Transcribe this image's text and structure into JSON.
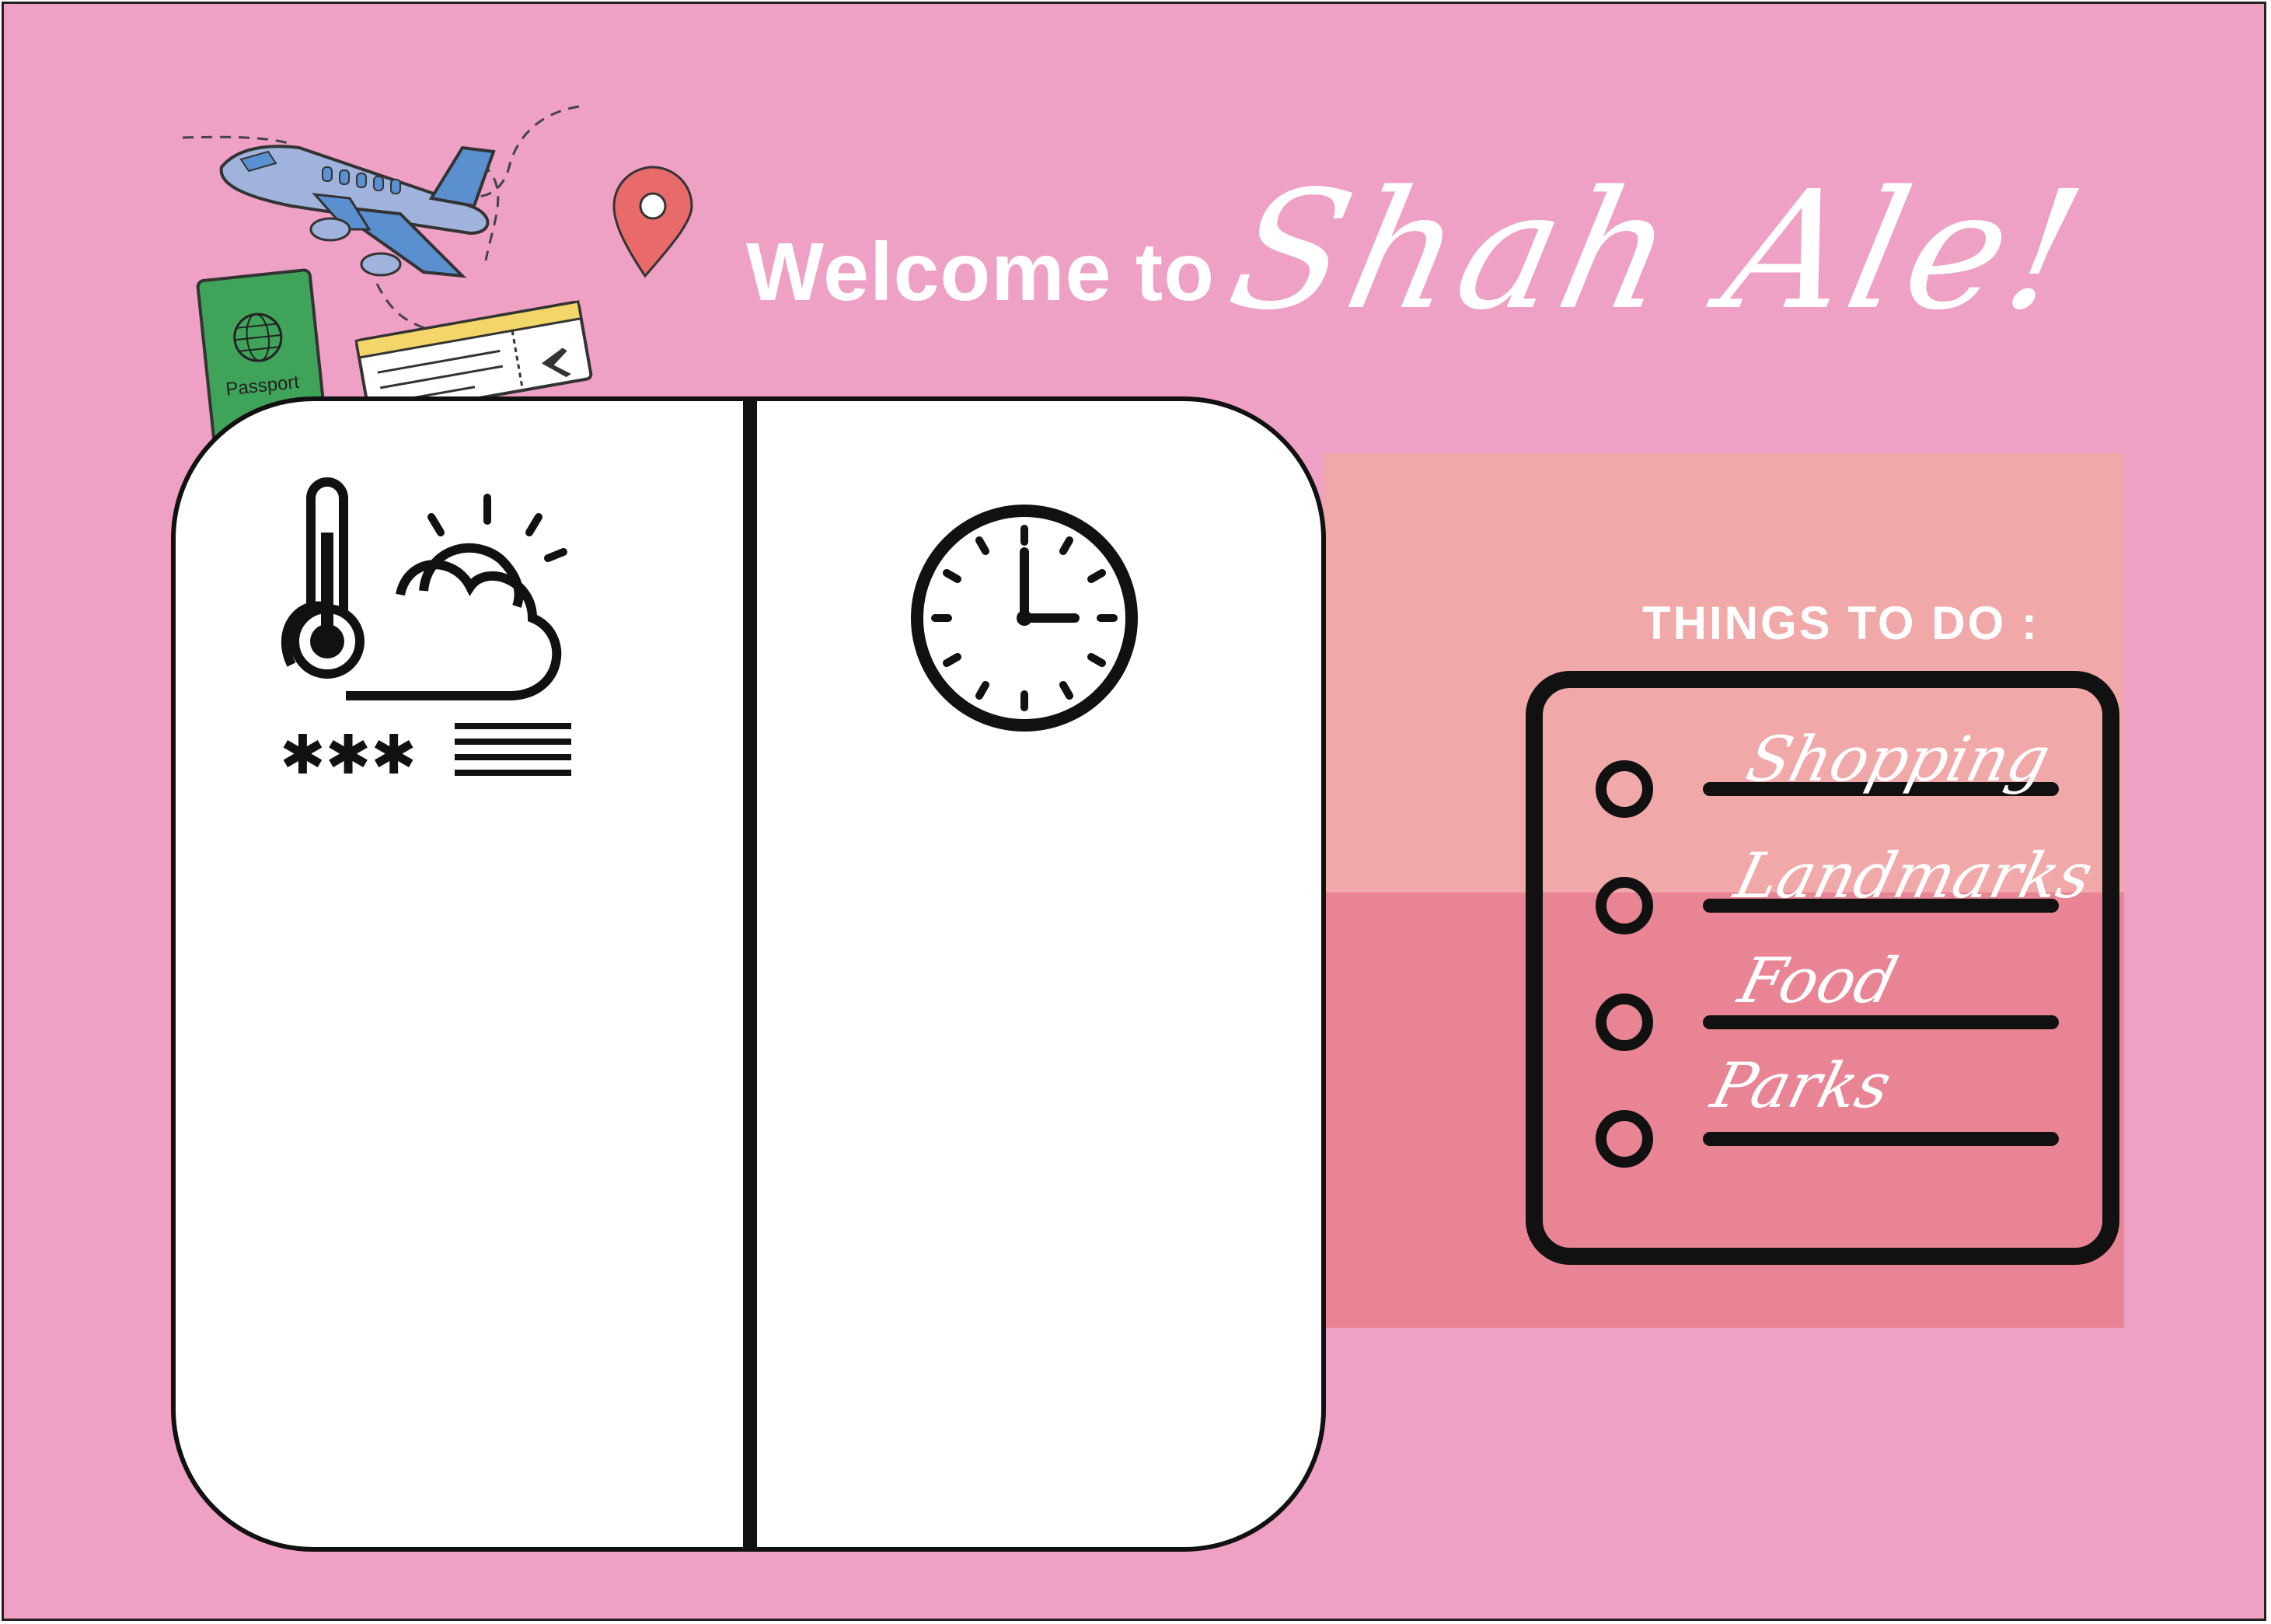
{
  "header": {
    "welcome_text": "Welcome to",
    "place_name": "Shah Ale!"
  },
  "things_to_do": {
    "heading": "THINGS TO DO  :",
    "items": [
      {
        "label": "Shopping"
      },
      {
        "label": "Landmarks"
      },
      {
        "label": "Food"
      },
      {
        "label": "Parks"
      }
    ]
  },
  "decorations": {
    "passport_label": "Passport"
  },
  "colors": {
    "background": "#efa0c5",
    "panel_top": "#f0a8a8",
    "panel_bottom": "#e88494",
    "passport": "#3fa35a",
    "airplane": "#9fb3dc",
    "pin": "#e86a6a",
    "ticket": "#f3d66a"
  },
  "icons": [
    "thermometer-weather-icon",
    "clock-icon",
    "checklist-icon",
    "airplane-icon",
    "passport-icon",
    "ticket-icon",
    "location-pin-icon"
  ]
}
